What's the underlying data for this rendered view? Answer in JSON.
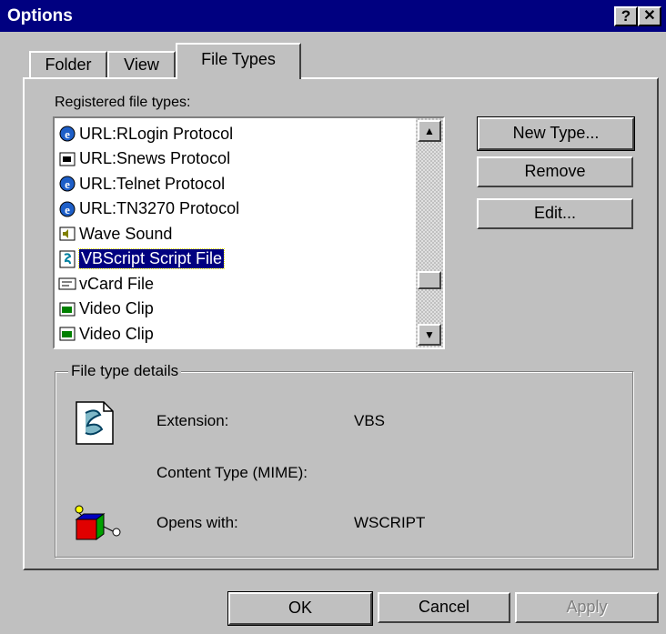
{
  "window": {
    "title": "Options",
    "help_button": "?",
    "close_button": "✕"
  },
  "tabs": [
    {
      "label": "Folder"
    },
    {
      "label": "View"
    },
    {
      "label": "File Types"
    }
  ],
  "registered": {
    "label": "Registered file types:",
    "items": [
      {
        "label": "URL:RLogin Protocol",
        "icon": "ie-icon"
      },
      {
        "label": "URL:Snews Protocol",
        "icon": "news-icon"
      },
      {
        "label": "URL:Telnet Protocol",
        "icon": "ie-icon"
      },
      {
        "label": "URL:TN3270 Protocol",
        "icon": "ie-icon"
      },
      {
        "label": "Wave Sound",
        "icon": "sound-icon"
      },
      {
        "label": "VBScript Script File",
        "icon": "script-icon",
        "selected": true
      },
      {
        "label": "vCard File",
        "icon": "vcard-icon"
      },
      {
        "label": "Video Clip",
        "icon": "video-icon"
      },
      {
        "label": "Video Clip",
        "icon": "video-icon"
      }
    ]
  },
  "side_buttons": {
    "new_type_label": "New Type...",
    "remove_label": "Remove",
    "edit_label": "Edit..."
  },
  "details": {
    "group_title": "File type details",
    "extension_label": "Extension:",
    "extension_value": "VBS",
    "content_type_label": "Content Type (MIME):",
    "content_type_value": "",
    "opens_with_label": "Opens with:",
    "opens_with_value": "WSCRIPT"
  },
  "footer": {
    "ok_label": "OK",
    "cancel_label": "Cancel",
    "apply_label": "Apply"
  },
  "colors": {
    "titlebar": "#000080",
    "face": "#c0c0c0",
    "selection": "#000080"
  }
}
